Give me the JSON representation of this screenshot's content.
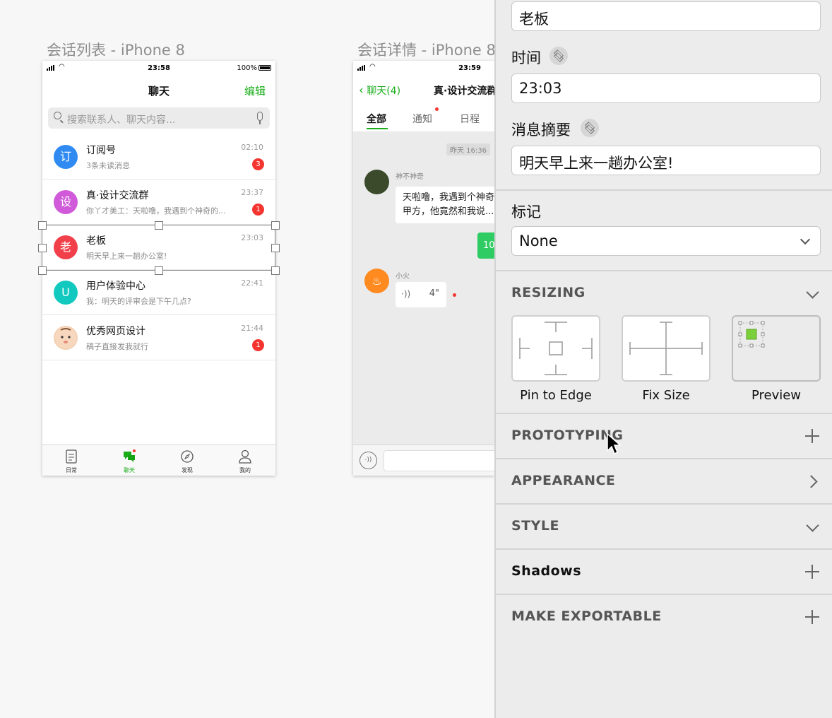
{
  "artboards": {
    "list_title": "会话列表 - iPhone 8",
    "detail_title": "会话详情 - iPhone 8"
  },
  "list_screen": {
    "status_time": "23:58",
    "battery": "100%",
    "nav_title": "聊天",
    "nav_edit": "编辑",
    "search_placeholder": "搜索联系人、聊天内容...",
    "chats": [
      {
        "avatar_text": "订",
        "avatar_color": "#2f8bf2",
        "name": "订阅号",
        "preview": "3条未读消息",
        "time": "02:10",
        "badge": "3"
      },
      {
        "avatar_text": "设",
        "avatar_color": "#d05ad9",
        "name": "真·设计交流群",
        "preview": "你丫才美工：天啦噜，我遇到个神奇的...",
        "time": "23:37",
        "badge": "1"
      },
      {
        "avatar_text": "老",
        "avatar_color": "#f2404a",
        "name": "老板",
        "preview": "明天早上来一趟办公室!",
        "time": "23:03",
        "badge": ""
      },
      {
        "avatar_text": "U",
        "avatar_color": "#12c9c0",
        "name": "用户体验中心",
        "preview": "我：明天的评审会是下午几点?",
        "time": "22:41",
        "badge": ""
      },
      {
        "avatar_text": "",
        "avatar_color": "#f3d1b4",
        "name": "优秀网页设计",
        "preview": "稿子直接发我就行",
        "time": "21:44",
        "badge": "1"
      }
    ],
    "tabs": [
      "日常",
      "聊天",
      "发现",
      "我的"
    ],
    "active_tab": "聊天"
  },
  "detail_screen": {
    "status_time": "23:59",
    "back_label": "聊天(4)",
    "nav_title": "真·设计交流群",
    "segments": [
      "全部",
      "通知",
      "日程"
    ],
    "time_chip": "昨天 16:36",
    "sender1": "神不神奇",
    "message1_line1": "天啦噜，我遇到个神奇的",
    "message1_line2": "甲方，他竟然和我说...",
    "my_message": "10",
    "sender2": "小火",
    "voice_duration": "4\""
  },
  "inspector": {
    "name_value": "老板",
    "time_label": "时间",
    "time_value": "23:03",
    "summary_label": "消息摘要",
    "summary_value": "明天早上来一趟办公室!",
    "mark_label": "标记",
    "mark_value": "None",
    "resizing_title": "RESIZING",
    "resize_options": [
      "Pin to Edge",
      "Fix Size",
      "Preview"
    ],
    "prototyping_title": "PROTOTYPING",
    "appearance_title": "APPEARANCE",
    "style_title": "STYLE",
    "shadows_title": "Shadows",
    "export_title": "MAKE EXPORTABLE"
  },
  "colors": {
    "accent_green": "#1aad19",
    "badge_red": "#f43530"
  }
}
